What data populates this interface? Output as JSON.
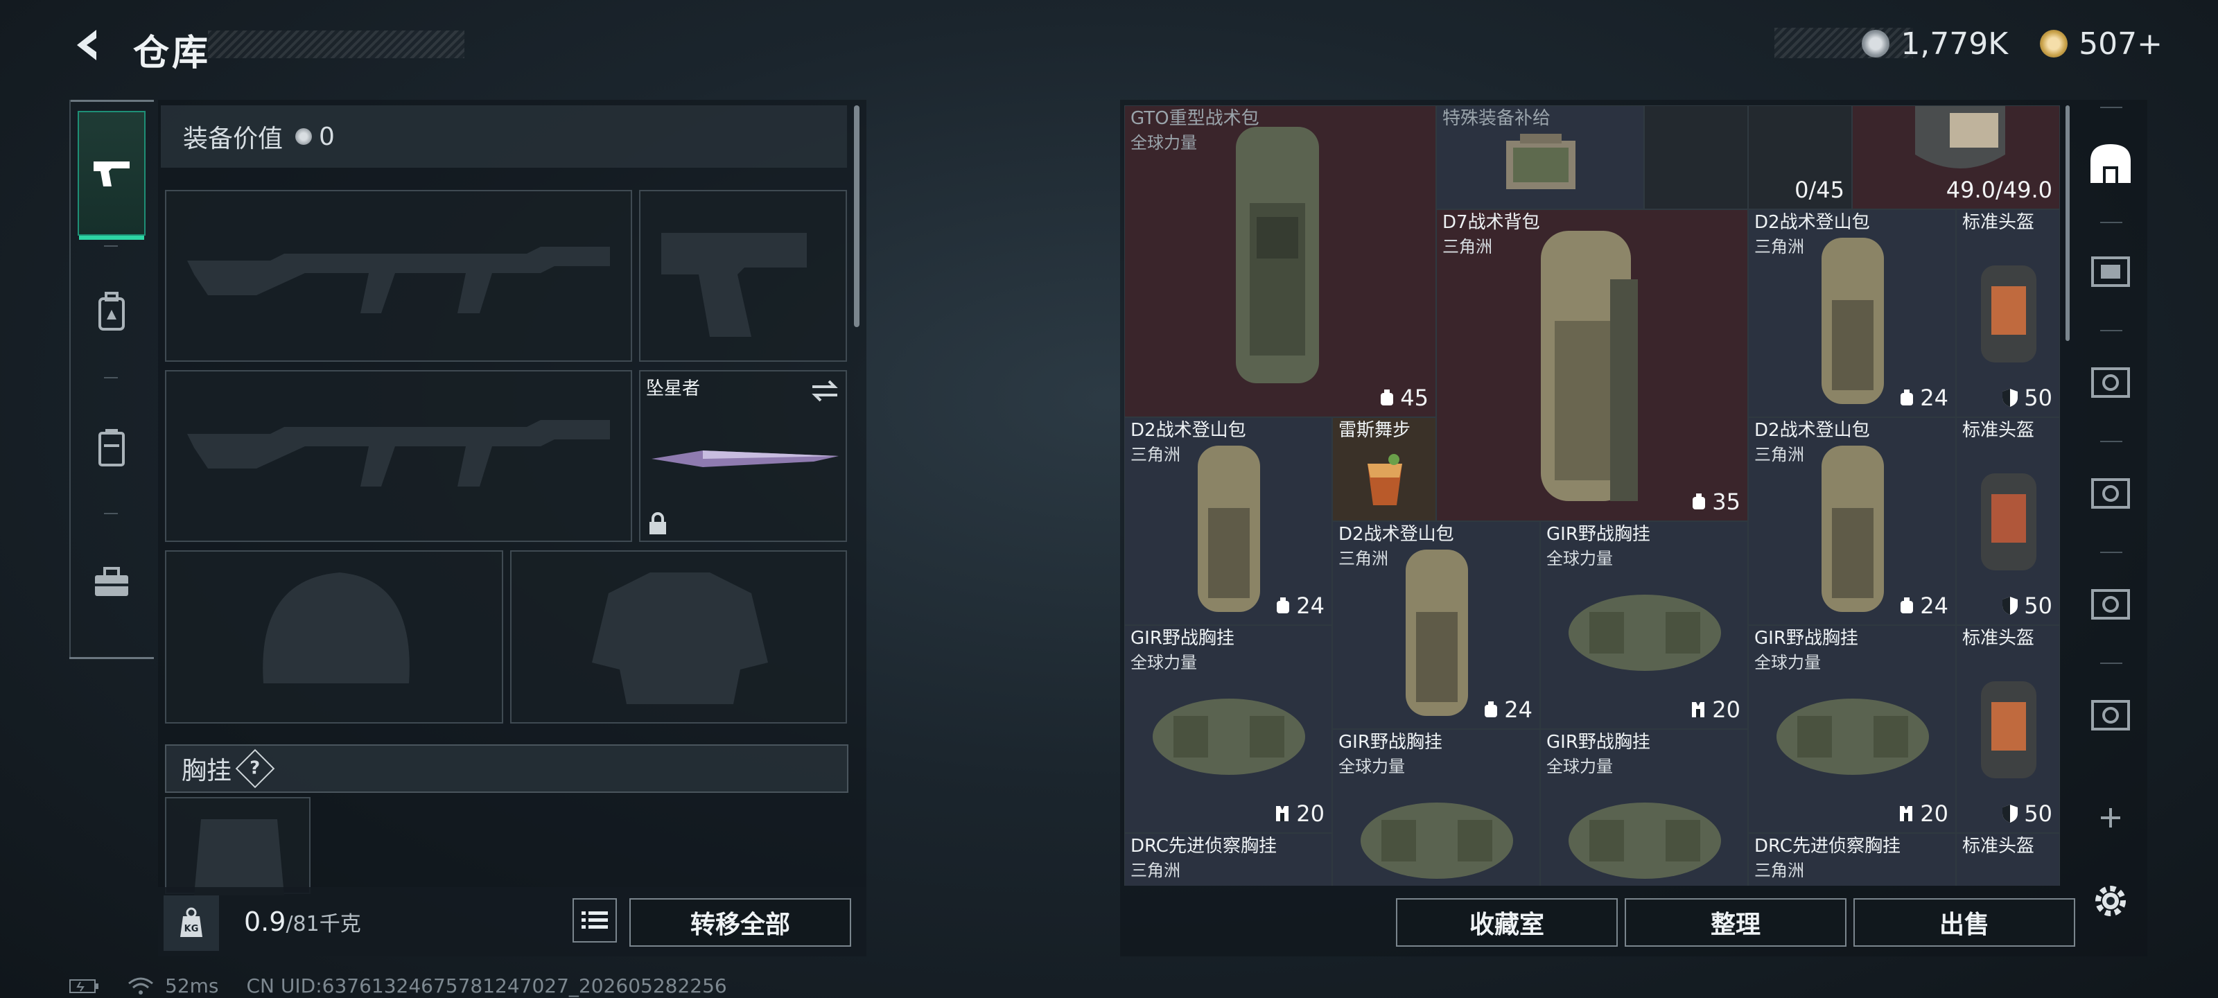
{
  "header": {
    "title": "仓库",
    "currency_a": "1,779K",
    "currency_b": "507+",
    "currency_a_color": "#9aa3aa",
    "currency_b_color": "#c9a24a"
  },
  "left_nav": {
    "items": [
      {
        "icon": "pistol-icon",
        "active": true
      },
      {
        "icon": "backpack-a-icon",
        "active": false
      },
      {
        "icon": "vest-icon",
        "active": false
      },
      {
        "icon": "toolbox-icon",
        "active": false
      }
    ]
  },
  "loadout": {
    "equip_value_label": "装备价值",
    "equip_value": "0",
    "melee_name": "坠星者",
    "chest_label": "胸挂",
    "chest_help": "?",
    "weight_current": "0.9",
    "weight_max": "/81千克",
    "weight_icon_label": "KG",
    "transfer_all": "转移全部"
  },
  "stash": {
    "items": [
      {
        "name": "GTO重型战术包",
        "sub": "全球力量",
        "value": "",
        "icon": "backpack-icon"
      },
      {
        "name": "特殊装备补给",
        "sub": "",
        "value": "",
        "icon": "supply-case-icon"
      },
      {
        "name": "",
        "sub": "",
        "value": "0/45",
        "icon": ""
      },
      {
        "name": "",
        "sub": "",
        "value": "49.0/49.0",
        "icon": "helmet-icon"
      },
      {
        "name": "",
        "sub": "",
        "value": "45",
        "icon": "backpack-capacity-icon"
      },
      {
        "name": "D7战术背包",
        "sub": "三角洲",
        "value": "35",
        "icon": "backpack-capacity-icon"
      },
      {
        "name": "D2战术登山包",
        "sub": "三角洲",
        "value": "24",
        "icon": "backpack-capacity-icon"
      },
      {
        "name": "标准头盔",
        "sub": "",
        "value": "50",
        "icon": "shield-icon"
      },
      {
        "name": "D2战术登山包",
        "sub": "三角洲",
        "value": "24",
        "icon": "backpack-capacity-icon"
      },
      {
        "name": "雷斯舞步",
        "sub": "",
        "value": "",
        "icon": "cocktail-icon"
      },
      {
        "name": "D2战术登山包",
        "sub": "三角洲",
        "value": "24",
        "icon": "backpack-capacity-icon"
      },
      {
        "name": "标准头盔",
        "sub": "",
        "value": "50",
        "icon": "shield-icon"
      },
      {
        "name": "D2战术登山包",
        "sub": "三角洲",
        "value": "24",
        "icon": "backpack-capacity-icon"
      },
      {
        "name": "GIR野战胸挂",
        "sub": "全球力量",
        "value": "20",
        "icon": "vest-capacity-icon"
      },
      {
        "name": "GIR野战胸挂",
        "sub": "全球力量",
        "value": "20",
        "icon": "vest-capacity-icon"
      },
      {
        "name": "GIR野战胸挂",
        "sub": "全球力量",
        "value": "20",
        "icon": "vest-capacity-icon"
      },
      {
        "name": "标准头盔",
        "sub": "",
        "value": "50",
        "icon": "shield-icon"
      },
      {
        "name": "GIR野战胸挂",
        "sub": "全球力量",
        "value": "",
        "icon": ""
      },
      {
        "name": "GIR野战胸挂",
        "sub": "全球力量",
        "value": "",
        "icon": ""
      },
      {
        "name": "DRC先进侦察胸挂",
        "sub": "三角洲",
        "value": "",
        "icon": ""
      },
      {
        "name": "DRC先进侦察胸挂",
        "sub": "三角洲",
        "value": "",
        "icon": ""
      },
      {
        "name": "标准头盔",
        "sub": "",
        "value": "",
        "icon": ""
      }
    ],
    "buttons": {
      "collection": "收藏室",
      "sort": "整理",
      "sell": "出售"
    }
  },
  "right_nav": {
    "items": [
      "stash-icon",
      "stash-tab-1-icon",
      "stash-tab-2-icon",
      "stash-tab-3-icon",
      "stash-tab-4-icon",
      "stash-tab-5-icon",
      "add-icon",
      "settings-icon"
    ]
  },
  "footer": {
    "ping": "52ms",
    "uid": "CN UID:6376132467578124702​7_202605282256"
  }
}
